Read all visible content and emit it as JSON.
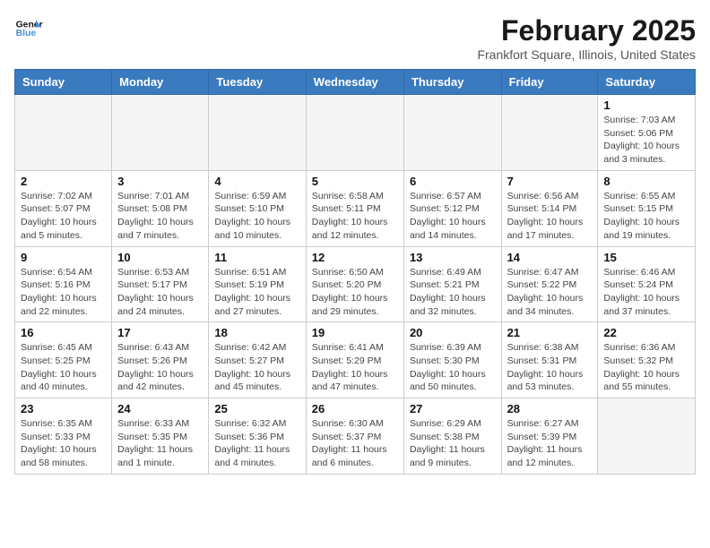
{
  "header": {
    "logo_line1": "General",
    "logo_line2": "Blue",
    "month_year": "February 2025",
    "location": "Frankfort Square, Illinois, United States"
  },
  "weekdays": [
    "Sunday",
    "Monday",
    "Tuesday",
    "Wednesday",
    "Thursday",
    "Friday",
    "Saturday"
  ],
  "weeks": [
    [
      {
        "day": "",
        "info": ""
      },
      {
        "day": "",
        "info": ""
      },
      {
        "day": "",
        "info": ""
      },
      {
        "day": "",
        "info": ""
      },
      {
        "day": "",
        "info": ""
      },
      {
        "day": "",
        "info": ""
      },
      {
        "day": "1",
        "info": "Sunrise: 7:03 AM\nSunset: 5:06 PM\nDaylight: 10 hours and 3 minutes."
      }
    ],
    [
      {
        "day": "2",
        "info": "Sunrise: 7:02 AM\nSunset: 5:07 PM\nDaylight: 10 hours and 5 minutes."
      },
      {
        "day": "3",
        "info": "Sunrise: 7:01 AM\nSunset: 5:08 PM\nDaylight: 10 hours and 7 minutes."
      },
      {
        "day": "4",
        "info": "Sunrise: 6:59 AM\nSunset: 5:10 PM\nDaylight: 10 hours and 10 minutes."
      },
      {
        "day": "5",
        "info": "Sunrise: 6:58 AM\nSunset: 5:11 PM\nDaylight: 10 hours and 12 minutes."
      },
      {
        "day": "6",
        "info": "Sunrise: 6:57 AM\nSunset: 5:12 PM\nDaylight: 10 hours and 14 minutes."
      },
      {
        "day": "7",
        "info": "Sunrise: 6:56 AM\nSunset: 5:14 PM\nDaylight: 10 hours and 17 minutes."
      },
      {
        "day": "8",
        "info": "Sunrise: 6:55 AM\nSunset: 5:15 PM\nDaylight: 10 hours and 19 minutes."
      }
    ],
    [
      {
        "day": "9",
        "info": "Sunrise: 6:54 AM\nSunset: 5:16 PM\nDaylight: 10 hours and 22 minutes."
      },
      {
        "day": "10",
        "info": "Sunrise: 6:53 AM\nSunset: 5:17 PM\nDaylight: 10 hours and 24 minutes."
      },
      {
        "day": "11",
        "info": "Sunrise: 6:51 AM\nSunset: 5:19 PM\nDaylight: 10 hours and 27 minutes."
      },
      {
        "day": "12",
        "info": "Sunrise: 6:50 AM\nSunset: 5:20 PM\nDaylight: 10 hours and 29 minutes."
      },
      {
        "day": "13",
        "info": "Sunrise: 6:49 AM\nSunset: 5:21 PM\nDaylight: 10 hours and 32 minutes."
      },
      {
        "day": "14",
        "info": "Sunrise: 6:47 AM\nSunset: 5:22 PM\nDaylight: 10 hours and 34 minutes."
      },
      {
        "day": "15",
        "info": "Sunrise: 6:46 AM\nSunset: 5:24 PM\nDaylight: 10 hours and 37 minutes."
      }
    ],
    [
      {
        "day": "16",
        "info": "Sunrise: 6:45 AM\nSunset: 5:25 PM\nDaylight: 10 hours and 40 minutes."
      },
      {
        "day": "17",
        "info": "Sunrise: 6:43 AM\nSunset: 5:26 PM\nDaylight: 10 hours and 42 minutes."
      },
      {
        "day": "18",
        "info": "Sunrise: 6:42 AM\nSunset: 5:27 PM\nDaylight: 10 hours and 45 minutes."
      },
      {
        "day": "19",
        "info": "Sunrise: 6:41 AM\nSunset: 5:29 PM\nDaylight: 10 hours and 47 minutes."
      },
      {
        "day": "20",
        "info": "Sunrise: 6:39 AM\nSunset: 5:30 PM\nDaylight: 10 hours and 50 minutes."
      },
      {
        "day": "21",
        "info": "Sunrise: 6:38 AM\nSunset: 5:31 PM\nDaylight: 10 hours and 53 minutes."
      },
      {
        "day": "22",
        "info": "Sunrise: 6:36 AM\nSunset: 5:32 PM\nDaylight: 10 hours and 55 minutes."
      }
    ],
    [
      {
        "day": "23",
        "info": "Sunrise: 6:35 AM\nSunset: 5:33 PM\nDaylight: 10 hours and 58 minutes."
      },
      {
        "day": "24",
        "info": "Sunrise: 6:33 AM\nSunset: 5:35 PM\nDaylight: 11 hours and 1 minute."
      },
      {
        "day": "25",
        "info": "Sunrise: 6:32 AM\nSunset: 5:36 PM\nDaylight: 11 hours and 4 minutes."
      },
      {
        "day": "26",
        "info": "Sunrise: 6:30 AM\nSunset: 5:37 PM\nDaylight: 11 hours and 6 minutes."
      },
      {
        "day": "27",
        "info": "Sunrise: 6:29 AM\nSunset: 5:38 PM\nDaylight: 11 hours and 9 minutes."
      },
      {
        "day": "28",
        "info": "Sunrise: 6:27 AM\nSunset: 5:39 PM\nDaylight: 11 hours and 12 minutes."
      },
      {
        "day": "",
        "info": ""
      }
    ]
  ]
}
